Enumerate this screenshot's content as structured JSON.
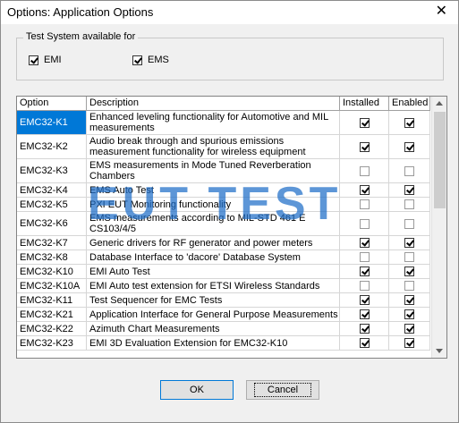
{
  "window": {
    "title": "Options: Application Options",
    "close_glyph": "✕"
  },
  "test_system": {
    "label": "Test System available for",
    "options": [
      {
        "label": "EMI",
        "checked": true
      },
      {
        "label": "EMS",
        "checked": true
      }
    ]
  },
  "table": {
    "headers": {
      "option": "Option",
      "description": "Description",
      "installed": "Installed",
      "enabled": "Enabled"
    },
    "rows": [
      {
        "option": "EMC32-K1",
        "description": "Enhanced leveling functionality for Automotive and MIL measurements",
        "installed": true,
        "enabled": true,
        "selected": true
      },
      {
        "option": "EMC32-K2",
        "description": "Audio break through and spurious emissions measurement functionality for wireless equipment",
        "installed": true,
        "enabled": true
      },
      {
        "option": "EMC32-K3",
        "description": "EMS measurements in Mode Tuned Reverberation Chambers",
        "installed": false,
        "enabled": false
      },
      {
        "option": "EMC32-K4",
        "description": "EMS Auto Test",
        "installed": true,
        "enabled": true
      },
      {
        "option": "EMC32-K5",
        "description": "PXI EUT Monitoring functionality",
        "installed": false,
        "enabled": false
      },
      {
        "option": "EMC32-K6",
        "description": "EMS measurements according to MIL-STD 461 E CS103/4/5",
        "installed": false,
        "enabled": false
      },
      {
        "option": "EMC32-K7",
        "description": "Generic drivers for RF generator and power meters",
        "installed": true,
        "enabled": true
      },
      {
        "option": "EMC32-K8",
        "description": "Database Interface to 'dacore' Database System",
        "installed": false,
        "enabled": false
      },
      {
        "option": "EMC32-K10",
        "description": "EMI Auto Test",
        "installed": true,
        "enabled": true
      },
      {
        "option": "EMC32-K10A",
        "description": "EMI Auto test extension for ETSI Wireless Standards",
        "installed": false,
        "enabled": false
      },
      {
        "option": "EMC32-K11",
        "description": "Test Sequencer for EMC Tests",
        "installed": true,
        "enabled": true
      },
      {
        "option": "EMC32-K21",
        "description": "Application Interface for General Purpose Measurements",
        "installed": true,
        "enabled": true
      },
      {
        "option": "EMC32-K22",
        "description": "Azimuth Chart Measurements",
        "installed": true,
        "enabled": true
      },
      {
        "option": "EMC32-K23",
        "description": "EMI 3D Evaluation Extension for EMC32-K10",
        "installed": true,
        "enabled": true
      }
    ]
  },
  "watermark": "EUT TEST",
  "buttons": {
    "ok": "OK",
    "cancel": "Cancel"
  }
}
